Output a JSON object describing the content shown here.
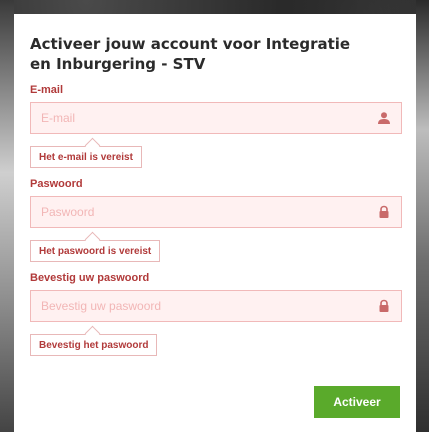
{
  "card": {
    "title": "Activeer jouw account voor Integratie en Inburgering - STV"
  },
  "fields": [
    {
      "label": "E-mail",
      "placeholder": "E-mail",
      "icon": "user-icon",
      "error": "Het e-mail is vereist"
    },
    {
      "label": "Paswoord",
      "placeholder": "Paswoord",
      "icon": "lock-icon",
      "error": "Het paswoord is vereist"
    },
    {
      "label": "Bevestig uw paswoord",
      "placeholder": "Bevestig uw paswoord",
      "icon": "lock-icon",
      "error": "Bevestig het paswoord"
    }
  ],
  "actions": {
    "submit_label": "Activeer"
  },
  "colors": {
    "error_text": "#b13a3a",
    "input_bg": "#fff1f1",
    "input_border": "#f1b9b9",
    "submit_bg": "#5aaa2b"
  }
}
